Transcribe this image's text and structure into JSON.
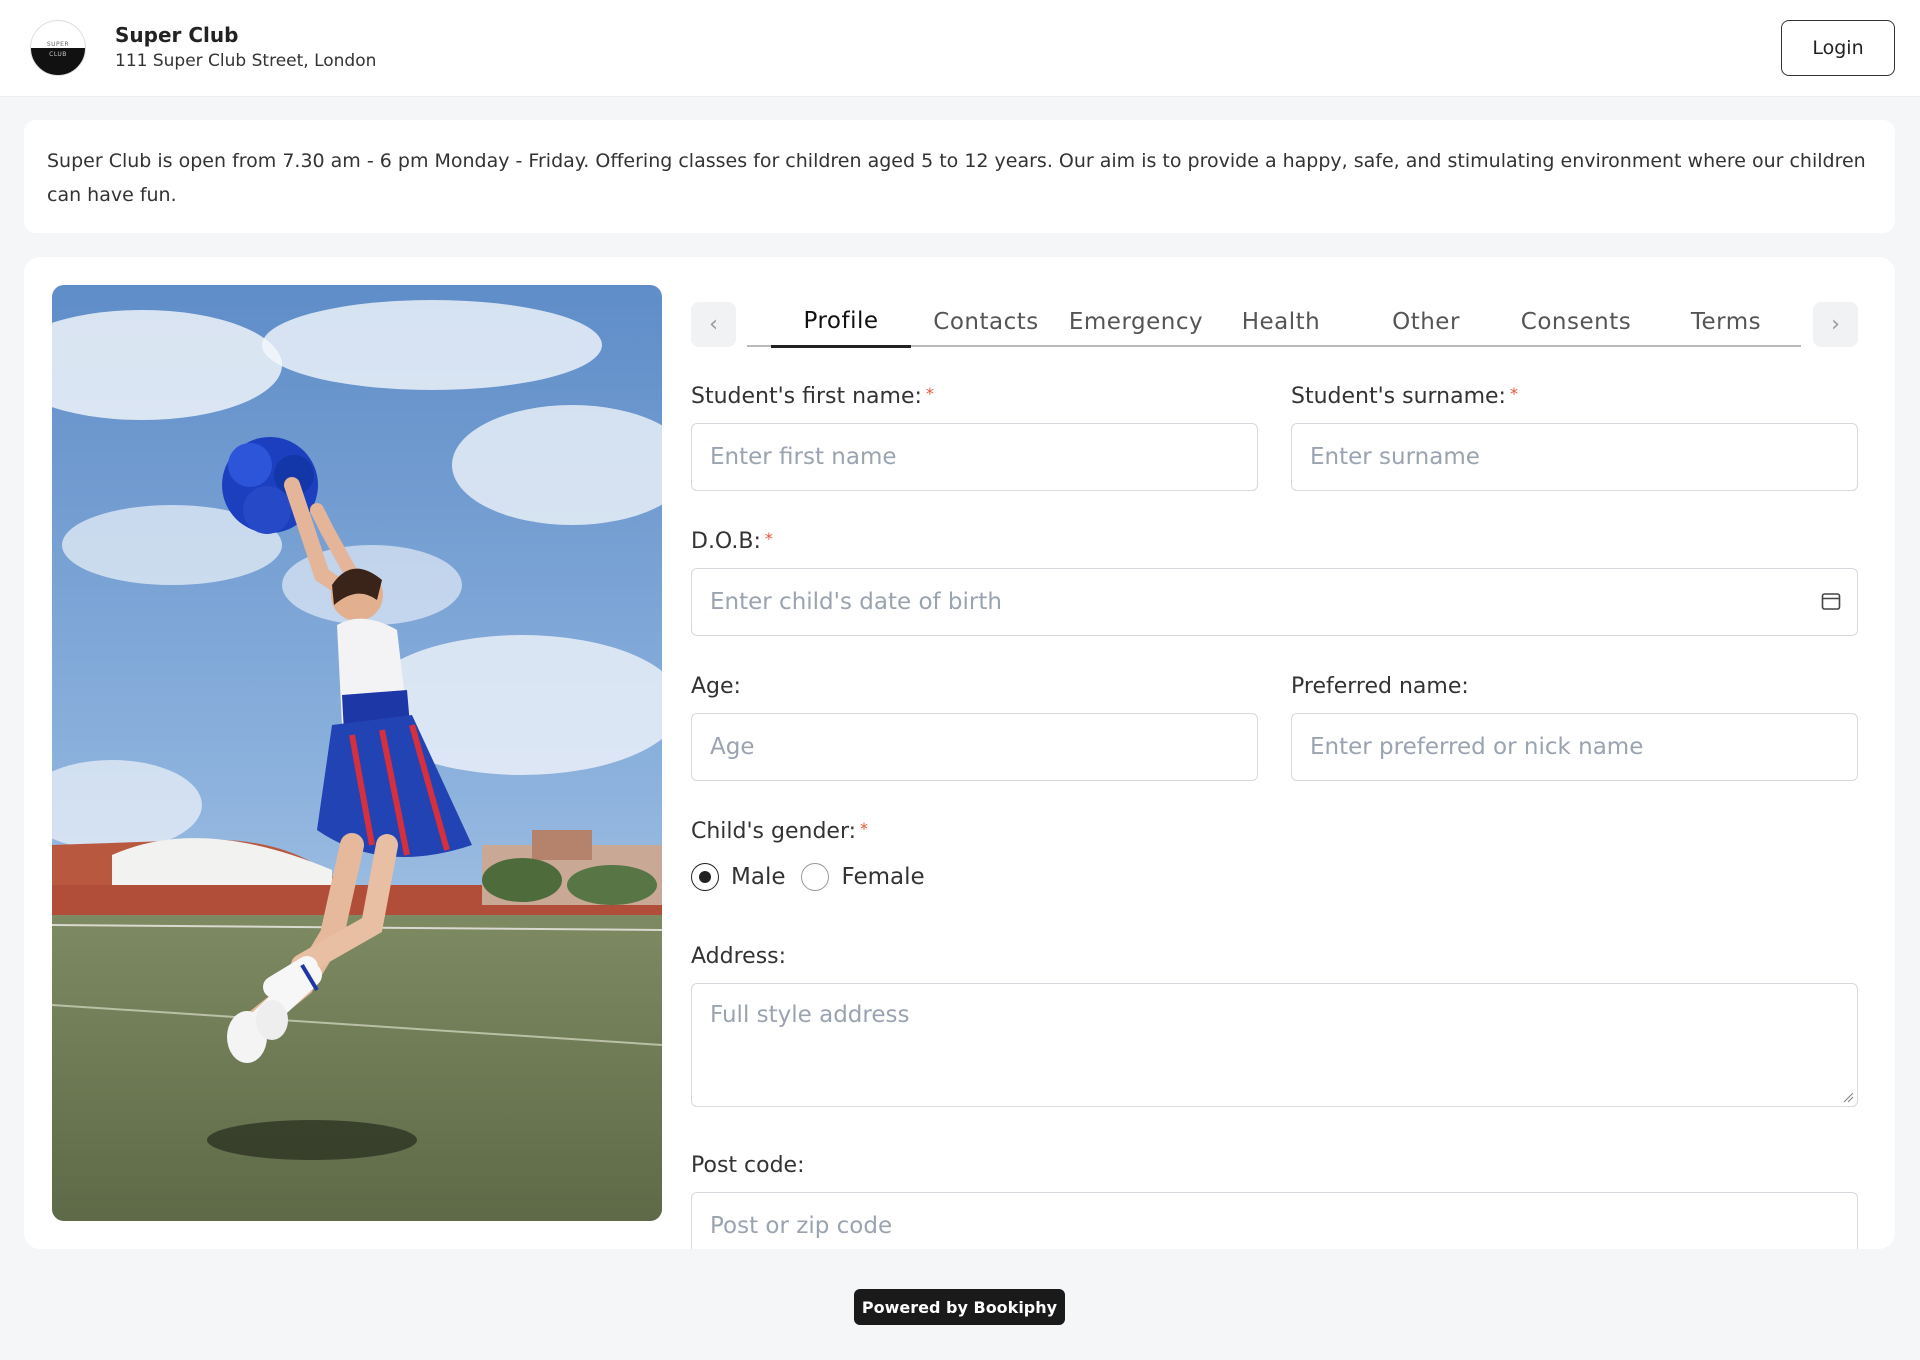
{
  "header": {
    "logo_text_top": "SUPER",
    "logo_text_bottom": "CLUB",
    "club_name": "Super Club",
    "club_address": "111 Super Club Street, London",
    "login_label": "Login"
  },
  "info": {
    "text": "Super Club is open from 7.30 am - 6 pm Monday - Friday. Offering classes for children aged 5 to 12 years. Our aim is to provide a happy, safe, and stimulating environment where our children can have fun."
  },
  "tabs": {
    "items": [
      {
        "label": "Profile",
        "active": true
      },
      {
        "label": "Contacts",
        "active": false
      },
      {
        "label": "Emergency",
        "active": false
      },
      {
        "label": "Health",
        "active": false
      },
      {
        "label": "Other",
        "active": false
      },
      {
        "label": "Consents",
        "active": false
      },
      {
        "label": "Terms",
        "active": false
      }
    ],
    "prev_icon": "chevron-left-icon",
    "next_icon": "chevron-right-icon"
  },
  "form": {
    "first_name": {
      "label": "Student's first name:",
      "required_mark": "*",
      "placeholder": "Enter first name",
      "value": ""
    },
    "surname": {
      "label": "Student's surname:",
      "required_mark": "*",
      "placeholder": "Enter surname",
      "value": ""
    },
    "dob": {
      "label": "D.O.B:",
      "required_mark": "*",
      "placeholder": "Enter child's date of birth",
      "value": ""
    },
    "age": {
      "label": "Age:",
      "placeholder": "Age",
      "value": ""
    },
    "preferred_name": {
      "label": "Preferred name:",
      "placeholder": "Enter preferred or nick name",
      "value": ""
    },
    "gender": {
      "label": "Child's gender:",
      "required_mark": "*",
      "options": [
        {
          "label": "Male",
          "checked": true
        },
        {
          "label": "Female",
          "checked": false
        }
      ]
    },
    "address": {
      "label": "Address:",
      "placeholder": "Full style address",
      "value": ""
    },
    "postcode": {
      "label": "Post code:",
      "placeholder": "Post or zip code",
      "value": ""
    }
  },
  "footer": {
    "powered_by": "Powered by Bookiphy"
  },
  "colors": {
    "required": "#e5533d",
    "border": "#d6d9de",
    "placeholder": "#9aa3b0",
    "footer_badge": "#1a1a1a"
  }
}
